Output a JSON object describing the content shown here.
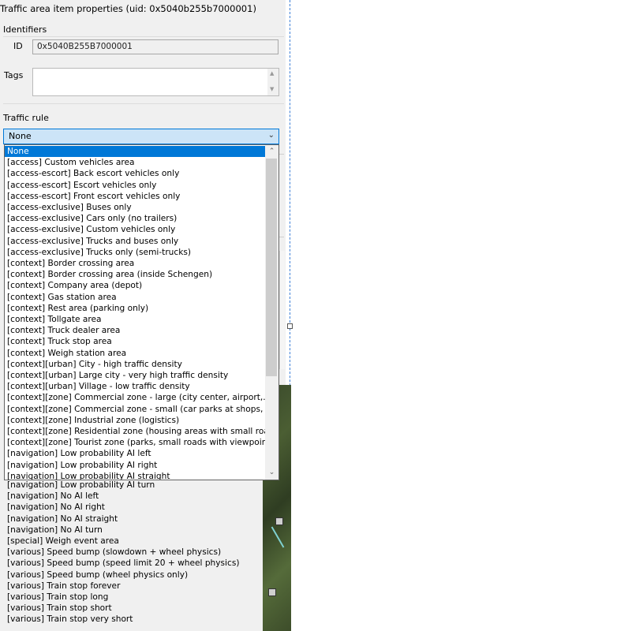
{
  "window": {
    "title": "Traffic area item properties (uid: 0x5040b255b7000001)"
  },
  "identifiers": {
    "group_label": "Identifiers",
    "id_label": "ID",
    "id_value": "0x5040B255B7000001",
    "tags_label": "Tags",
    "tags_value": ""
  },
  "traffic_rule": {
    "group_label": "Traffic rule",
    "selected": "None",
    "options_visible_in_list": [
      "None",
      "[access] Custom vehicles area",
      "[access-escort] Back escort vehicles only",
      "[access-escort] Escort vehicles only",
      "[access-escort] Front escort vehicles only",
      "[access-exclusive] Buses only",
      "[access-exclusive] Cars only (no trailers)",
      "[access-exclusive] Custom vehicles only",
      "[access-exclusive] Trucks and buses only",
      "[access-exclusive] Trucks only (semi-trucks)",
      "[context] Border crossing area",
      "[context] Border crossing area (inside Schengen)",
      "[context] Company area (depot)",
      "[context] Gas station area",
      "[context] Rest area (parking only)",
      "[context] Tollgate area",
      "[context] Truck dealer area",
      "[context] Truck stop area",
      "[context] Weigh station area",
      "[context][urban] City - high traffic density",
      "[context][urban] Large city - very high traffic density",
      "[context][urban] Village - low traffic density",
      "[context][zone] Commercial zone - large (city center, airport,...)",
      "[context][zone] Commercial zone - small (car parks at shops, office",
      "[context][zone] Industrial zone (logistics)",
      "[context][zone] Residential zone (housing areas with small roads)",
      "[context][zone] Tourist zone (parks, small roads with viewpoints, ...",
      "[navigation] Low probability AI left",
      "[navigation] Low probability AI right",
      "[navigation] Low probability AI straight"
    ],
    "options_below_list": [
      "[navigation] Low probability AI turn",
      "[navigation] No AI left",
      "[navigation] No AI right",
      "[navigation] No AI straight",
      "[navigation] No AI turn",
      "[special] Weigh event area",
      "[various] Speed bump (slowdown + wheel physics)",
      "[various] Speed bump (speed limit 20 + wheel physics)",
      "[various] Speed bump (wheel physics only)",
      "[various] Train stop forever",
      "[various] Train stop long",
      "[various] Train stop short",
      "[various] Train stop very short"
    ]
  },
  "icons": {
    "combo_chevron": "chevron-down-icon",
    "scroll_up": "chevron-up-icon",
    "scroll_down": "chevron-down-icon"
  },
  "colors": {
    "selection": "#0078d7",
    "combo_focus_bg": "#cce4f7",
    "panel_bg": "#f0f0f0",
    "guide_line": "#3c7fd8"
  }
}
